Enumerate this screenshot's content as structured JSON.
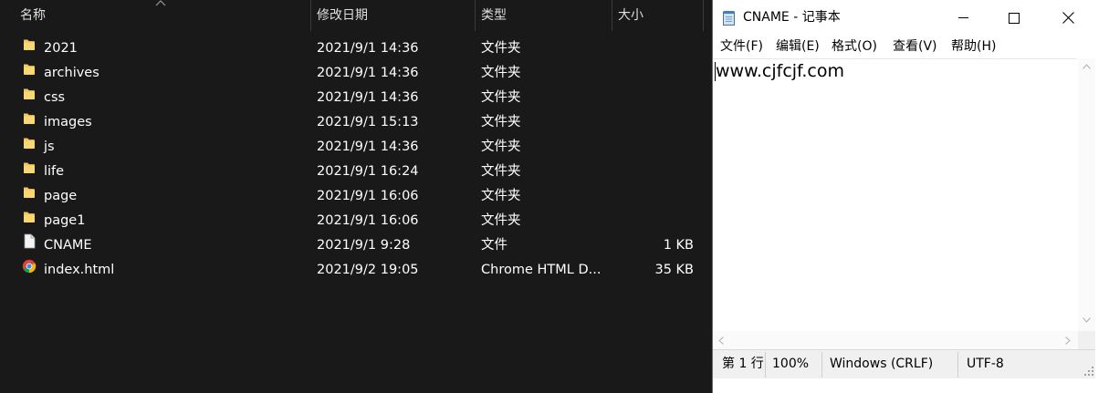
{
  "explorer": {
    "columns": {
      "name": "名称",
      "date": "修改日期",
      "type": "类型",
      "size": "大小"
    },
    "files": [
      {
        "name": "2021",
        "date": "2021/9/1 14:36",
        "type": "文件夹",
        "size": "",
        "icon": "folder-icon"
      },
      {
        "name": "archives",
        "date": "2021/9/1 14:36",
        "type": "文件夹",
        "size": "",
        "icon": "folder-icon"
      },
      {
        "name": "css",
        "date": "2021/9/1 14:36",
        "type": "文件夹",
        "size": "",
        "icon": "folder-icon"
      },
      {
        "name": "images",
        "date": "2021/9/1 15:13",
        "type": "文件夹",
        "size": "",
        "icon": "folder-icon"
      },
      {
        "name": "js",
        "date": "2021/9/1 14:36",
        "type": "文件夹",
        "size": "",
        "icon": "folder-icon"
      },
      {
        "name": "life",
        "date": "2021/9/1 16:24",
        "type": "文件夹",
        "size": "",
        "icon": "folder-icon"
      },
      {
        "name": "page",
        "date": "2021/9/1 16:06",
        "type": "文件夹",
        "size": "",
        "icon": "folder-icon"
      },
      {
        "name": "page1",
        "date": "2021/9/1 16:06",
        "type": "文件夹",
        "size": "",
        "icon": "folder-icon"
      },
      {
        "name": "CNAME",
        "date": "2021/9/1 9:28",
        "type": "文件",
        "size": "1 KB",
        "icon": "file-icon"
      },
      {
        "name": "index.html",
        "date": "2021/9/2 19:05",
        "type": "Chrome HTML D...",
        "size": "35 KB",
        "icon": "chrome-icon"
      }
    ]
  },
  "notepad": {
    "title": "CNAME - 记事本",
    "menu": [
      "文件(F)",
      "编辑(E)",
      "格式(O)",
      "查看(V)",
      "帮助(H)"
    ],
    "content": "www.cjfcjf.com",
    "status": {
      "position": "第 1 行",
      "zoom": "100%",
      "line_ending": "Windows (CRLF)",
      "encoding": "UTF-8"
    }
  },
  "colors": {
    "explorer_bg": "#191919",
    "folder": "#f2c55c",
    "notepad_bg": "#ffffff",
    "statusbar_bg": "#f0f0f0"
  }
}
